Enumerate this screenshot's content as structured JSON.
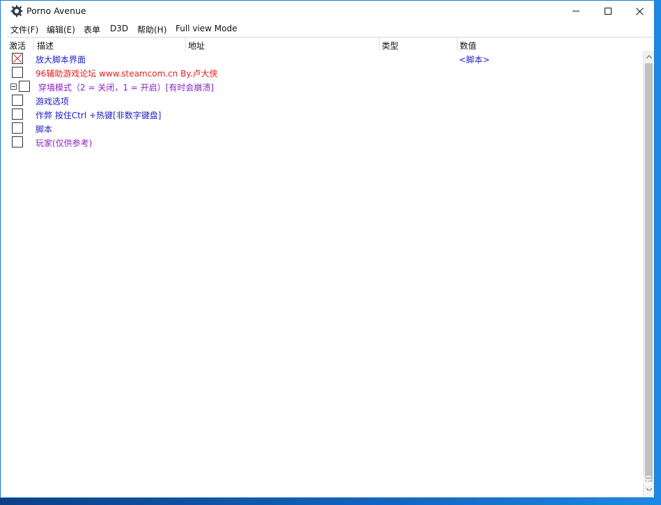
{
  "window": {
    "title": "Porno Avenue"
  },
  "menu": [
    {
      "label": "文件(F)"
    },
    {
      "label": "编辑(E)"
    },
    {
      "label": "表单"
    },
    {
      "label": "D3D"
    },
    {
      "label": "帮助(H)"
    },
    {
      "label": "Full view Mode"
    }
  ],
  "columns": {
    "active": "激活",
    "description": "描述",
    "address": "地址",
    "type": "类型",
    "value": "数值"
  },
  "entries": [
    {
      "description": "放大脚本界面",
      "value": "<脚本>",
      "color": "#1e1ec8",
      "checked": true,
      "expander": false
    },
    {
      "description": "96辅助游戏论坛 www.steamcom.cn By.卢大侠",
      "value": "",
      "color": "#e02020",
      "checked": false,
      "expander": false
    },
    {
      "description": "穿墙模式（2 = 关闭，1 = 开启）[有时会崩溃]",
      "value": "",
      "color": "#8a1fc8",
      "checked": false,
      "expander": true
    },
    {
      "description": "游戏选项",
      "value": "",
      "color": "#1e1ec8",
      "checked": false,
      "expander": false
    },
    {
      "description": "作弊 按住Ctrl +热键[非数字键盘]",
      "value": "",
      "color": "#1e1ec8",
      "checked": false,
      "expander": false
    },
    {
      "description": "脚本",
      "value": "",
      "color": "#1e1ec8",
      "checked": false,
      "expander": false
    },
    {
      "description": "玩家(仅供参考)",
      "value": "",
      "color": "#8a1fc8",
      "checked": false,
      "expander": false
    }
  ],
  "watermark": {
    "line1": "96辅助游戏论坛",
    "line2": "www.steamcom.cn"
  },
  "icons": {
    "app": "cheat-engine-gear-icon",
    "minimize": "minimize-icon",
    "maximize": "maximize-icon",
    "close": "close-icon"
  }
}
